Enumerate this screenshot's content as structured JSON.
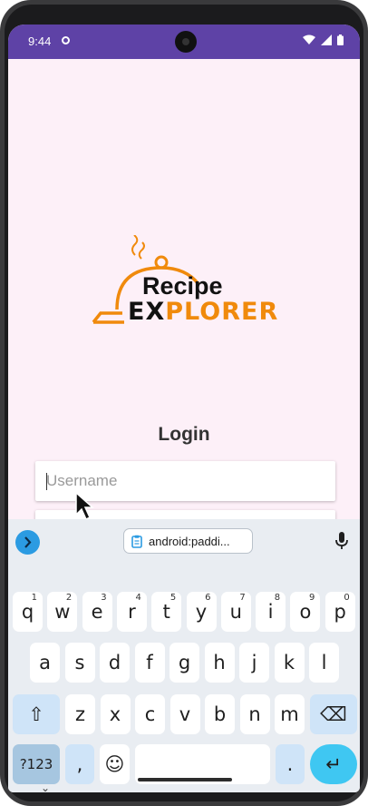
{
  "status_bar": {
    "time": "9:44",
    "icons": [
      "notification-dot-icon",
      "wifi-icon",
      "signal-icon",
      "battery-icon"
    ]
  },
  "logo": {
    "line1": "Recipe",
    "line2_dark": "EX",
    "line2_accent": "PLORER",
    "accent_color": "#f08a0c"
  },
  "login": {
    "title": "Login",
    "username_placeholder": "Username",
    "password_placeholder": ""
  },
  "keyboard": {
    "suggestion_chip": "android:paddi...",
    "row1": [
      {
        "key": "q",
        "hint": "1"
      },
      {
        "key": "w",
        "hint": "2"
      },
      {
        "key": "e",
        "hint": "3"
      },
      {
        "key": "r",
        "hint": "4"
      },
      {
        "key": "t",
        "hint": "5"
      },
      {
        "key": "y",
        "hint": "6"
      },
      {
        "key": "u",
        "hint": "7"
      },
      {
        "key": "i",
        "hint": "8"
      },
      {
        "key": "o",
        "hint": "9"
      },
      {
        "key": "p",
        "hint": "0"
      }
    ],
    "row2": [
      "a",
      "s",
      "d",
      "f",
      "g",
      "h",
      "j",
      "k",
      "l"
    ],
    "row3": [
      "z",
      "x",
      "c",
      "v",
      "b",
      "n",
      "m"
    ],
    "numbers_label": "?123",
    "comma_label": ",",
    "period_label": ".",
    "emoji_label": "☺",
    "shift_label": "⇧",
    "backspace_label": "⌫",
    "enter_label": "↵"
  },
  "colors": {
    "status_bar": "#5e42a6",
    "background": "#fdf0f8",
    "keyboard_bg": "#e9edf2",
    "enter_key": "#3fc7f2"
  }
}
